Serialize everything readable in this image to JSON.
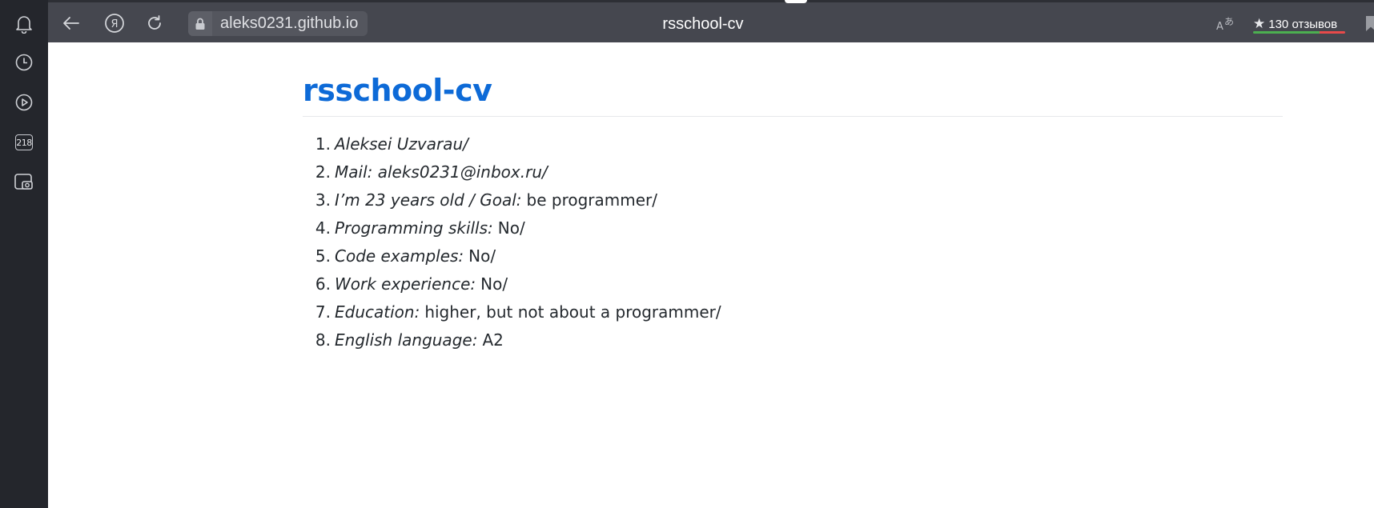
{
  "sidebar": {
    "items": [
      {
        "name": "bell-icon"
      },
      {
        "name": "clock-icon"
      },
      {
        "name": "play-icon"
      },
      {
        "name": "tabs-count-badge",
        "label": "218"
      },
      {
        "name": "screenshot-icon"
      }
    ]
  },
  "toolbar": {
    "url": "aleks0231.github.io",
    "title": "rsschool-cv",
    "reviews_label": "130 отзывов"
  },
  "page": {
    "heading": "rsschool-cv",
    "items": [
      {
        "num": "1.",
        "italic": "Aleksei Uzvarau/",
        "text": ""
      },
      {
        "num": "2.",
        "italic": "Mail: aleks0231@inbox.ru/",
        "text": ""
      },
      {
        "num": "3.",
        "italic": "I’m 23 years old / Goal:",
        "text": "be programmer/"
      },
      {
        "num": "4.",
        "italic": "Programming skills:",
        "text": "No/"
      },
      {
        "num": "5.",
        "italic": "Code examples:",
        "text": "No/"
      },
      {
        "num": "6.",
        "italic": "Work experience:",
        "text": "No/"
      },
      {
        "num": "7.",
        "italic": "Education:",
        "text": "higher, but not about a programmer/"
      },
      {
        "num": "8.",
        "italic": "English language:",
        "text": "A2"
      }
    ]
  },
  "colors": {
    "heading": "#0d6ad7",
    "toolbar_bg": "#45474f",
    "sidebar_bg": "#24262c"
  }
}
